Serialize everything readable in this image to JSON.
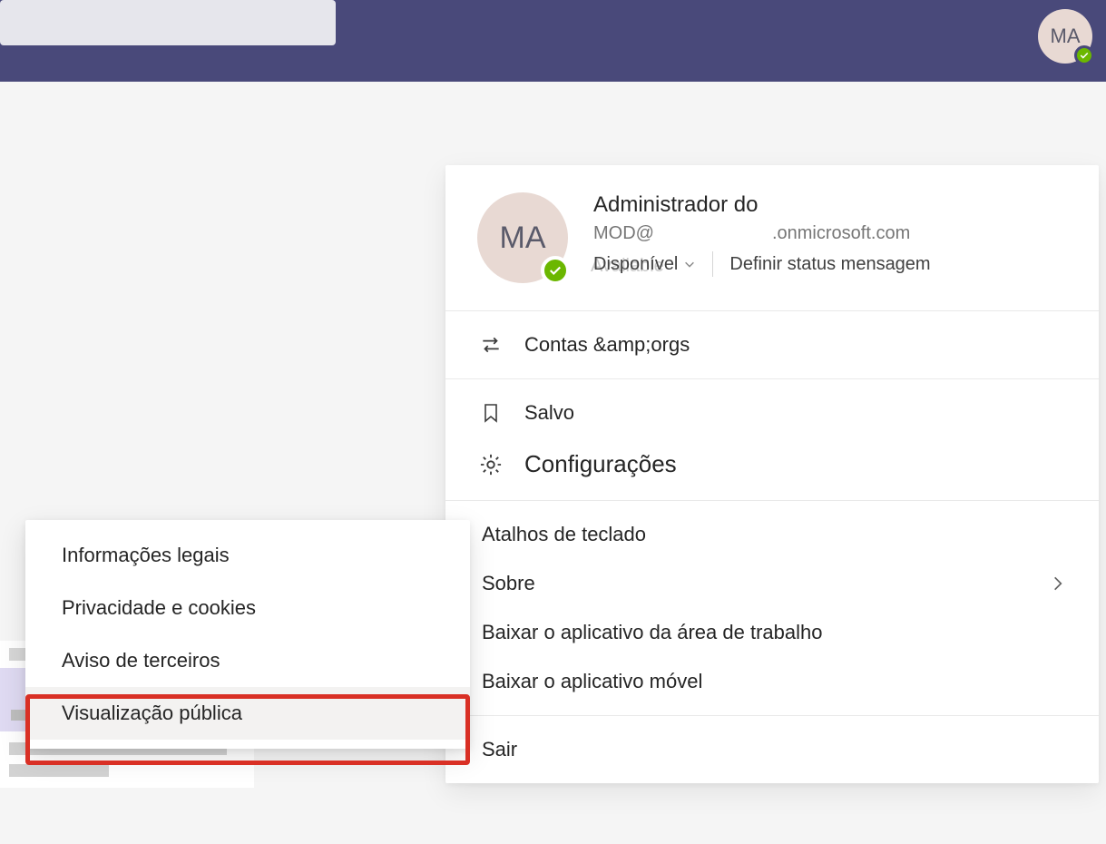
{
  "titlebar": {
    "avatar_initials": "MA"
  },
  "profile": {
    "avatar_initials": "MA",
    "name": "Administrador do",
    "email_local": "MOD@",
    "email_domain": ".onmicrosoft.com",
    "status_label": "Disponível",
    "status_ghost": "Available",
    "set_status_label": "Definir status mensagem"
  },
  "menu": {
    "accounts_orgs": "Contas &amp;orgs",
    "saved": "Salvo",
    "settings": "Configurações",
    "keyboard_shortcuts": "Atalhos de teclado",
    "about": "Sobre",
    "download_desktop": "Baixar o aplicativo da área de trabalho",
    "download_mobile": "Baixar o aplicativo móvel",
    "sign_out": "Sair"
  },
  "submenu": {
    "items": [
      "Informações legais",
      "Privacidade e cookies",
      "Aviso de terceiros",
      "Visualização pública"
    ]
  },
  "colors": {
    "titlebar": "#49497a",
    "presence": "#6bb700",
    "highlight": "#d93025"
  }
}
